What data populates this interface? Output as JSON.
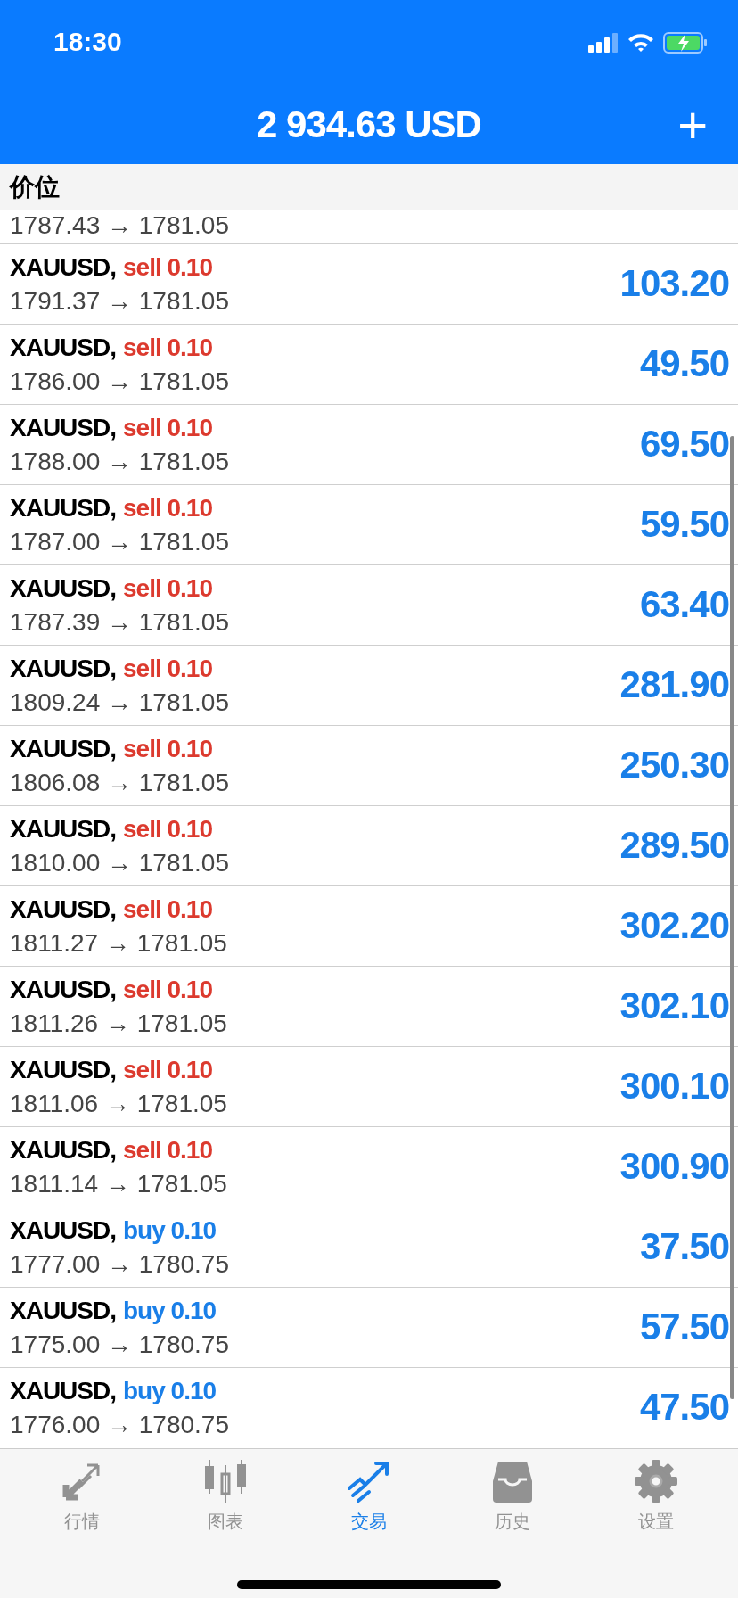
{
  "status_bar": {
    "time": "18:30"
  },
  "header": {
    "title": "2 934.63 USD",
    "add_button": "+"
  },
  "section": {
    "title": "价位"
  },
  "partial_row": {
    "prices": "1787.43 → 1781.05"
  },
  "positions": [
    {
      "symbol": "XAUUSD,",
      "kind": "sell",
      "order": "sell 0.10",
      "prices": "1791.37 → 1781.05",
      "profit": "103.20"
    },
    {
      "symbol": "XAUUSD,",
      "kind": "sell",
      "order": "sell 0.10",
      "prices": "1786.00 → 1781.05",
      "profit": "49.50"
    },
    {
      "symbol": "XAUUSD,",
      "kind": "sell",
      "order": "sell 0.10",
      "prices": "1788.00 → 1781.05",
      "profit": "69.50"
    },
    {
      "symbol": "XAUUSD,",
      "kind": "sell",
      "order": "sell 0.10",
      "prices": "1787.00 → 1781.05",
      "profit": "59.50"
    },
    {
      "symbol": "XAUUSD,",
      "kind": "sell",
      "order": "sell 0.10",
      "prices": "1787.39 → 1781.05",
      "profit": "63.40"
    },
    {
      "symbol": "XAUUSD,",
      "kind": "sell",
      "order": "sell 0.10",
      "prices": "1809.24 → 1781.05",
      "profit": "281.90"
    },
    {
      "symbol": "XAUUSD,",
      "kind": "sell",
      "order": "sell 0.10",
      "prices": "1806.08 → 1781.05",
      "profit": "250.30"
    },
    {
      "symbol": "XAUUSD,",
      "kind": "sell",
      "order": "sell 0.10",
      "prices": "1810.00 → 1781.05",
      "profit": "289.50"
    },
    {
      "symbol": "XAUUSD,",
      "kind": "sell",
      "order": "sell 0.10",
      "prices": "1811.27 → 1781.05",
      "profit": "302.20"
    },
    {
      "symbol": "XAUUSD,",
      "kind": "sell",
      "order": "sell 0.10",
      "prices": "1811.26 → 1781.05",
      "profit": "302.10"
    },
    {
      "symbol": "XAUUSD,",
      "kind": "sell",
      "order": "sell 0.10",
      "prices": "1811.06 → 1781.05",
      "profit": "300.10"
    },
    {
      "symbol": "XAUUSD,",
      "kind": "sell",
      "order": "sell 0.10",
      "prices": "1811.14 → 1781.05",
      "profit": "300.90"
    },
    {
      "symbol": "XAUUSD,",
      "kind": "buy",
      "order": "buy 0.10",
      "prices": "1777.00 → 1780.75",
      "profit": "37.50"
    },
    {
      "symbol": "XAUUSD,",
      "kind": "buy",
      "order": "buy 0.10",
      "prices": "1775.00 → 1780.75",
      "profit": "57.50"
    },
    {
      "symbol": "XAUUSD,",
      "kind": "buy",
      "order": "buy 0.10",
      "prices": "1776.00 → 1780.75",
      "profit": "47.50"
    }
  ],
  "tab_bar": [
    {
      "label": "行情",
      "kind": "quotes",
      "selected": false
    },
    {
      "label": "图表",
      "kind": "chart",
      "selected": false
    },
    {
      "label": "交易",
      "kind": "trade",
      "selected": true
    },
    {
      "label": "历史",
      "kind": "history",
      "selected": false
    },
    {
      "label": "设置",
      "kind": "settings",
      "selected": false
    }
  ]
}
